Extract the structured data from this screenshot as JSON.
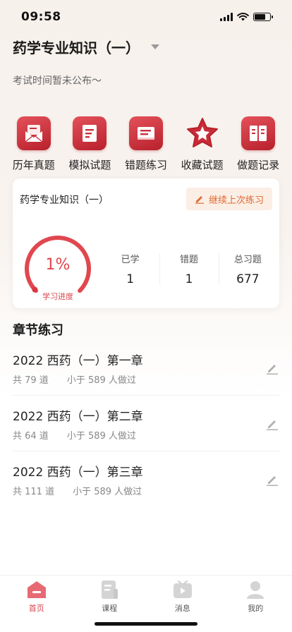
{
  "status_bar": {
    "time": "09:58"
  },
  "header": {
    "subject": "药学专业知识（一）",
    "exam_time": "考试时间暂未公布～"
  },
  "quick_nav": [
    {
      "label": "历年真题",
      "icon": "envelope-paper-icon"
    },
    {
      "label": "模拟试题",
      "icon": "document-icon"
    },
    {
      "label": "错题练习",
      "icon": "error-book-icon"
    },
    {
      "label": "收藏试题",
      "icon": "star-icon"
    },
    {
      "label": "做题记录",
      "icon": "open-book-icon"
    }
  ],
  "progress_card": {
    "title": "药学专业知识（一）",
    "continue_label": "继续上次练习",
    "progress_percent": "1%",
    "progress_value": 0.01,
    "progress_label": "学习进度",
    "stats": [
      {
        "label": "已学",
        "value": "1"
      },
      {
        "label": "错题",
        "value": "1"
      },
      {
        "label": "总习题",
        "value": "677"
      }
    ]
  },
  "chapter_section": {
    "title": "章节练习",
    "chapters": [
      {
        "name": "2022 西药（一）第一章",
        "count": "共 79 道",
        "done": "小于 589 人做过"
      },
      {
        "name": "2022 西药（一）第二章",
        "count": "共 64 道",
        "done": "小于 589 人做过"
      },
      {
        "name": "2022 西药（一）第三章",
        "count": "共 111 道",
        "done": "小于 589 人做过"
      }
    ]
  },
  "tab_bar": [
    {
      "label": "首页",
      "icon": "home-icon",
      "active": true
    },
    {
      "label": "课程",
      "icon": "course-icon",
      "active": false
    },
    {
      "label": "消息",
      "icon": "message-icon",
      "active": false
    },
    {
      "label": "我的",
      "icon": "profile-icon",
      "active": false
    }
  ],
  "colors": {
    "accent": "#d8434c",
    "orange": "#e06a32",
    "background": "#f7f1ec"
  }
}
